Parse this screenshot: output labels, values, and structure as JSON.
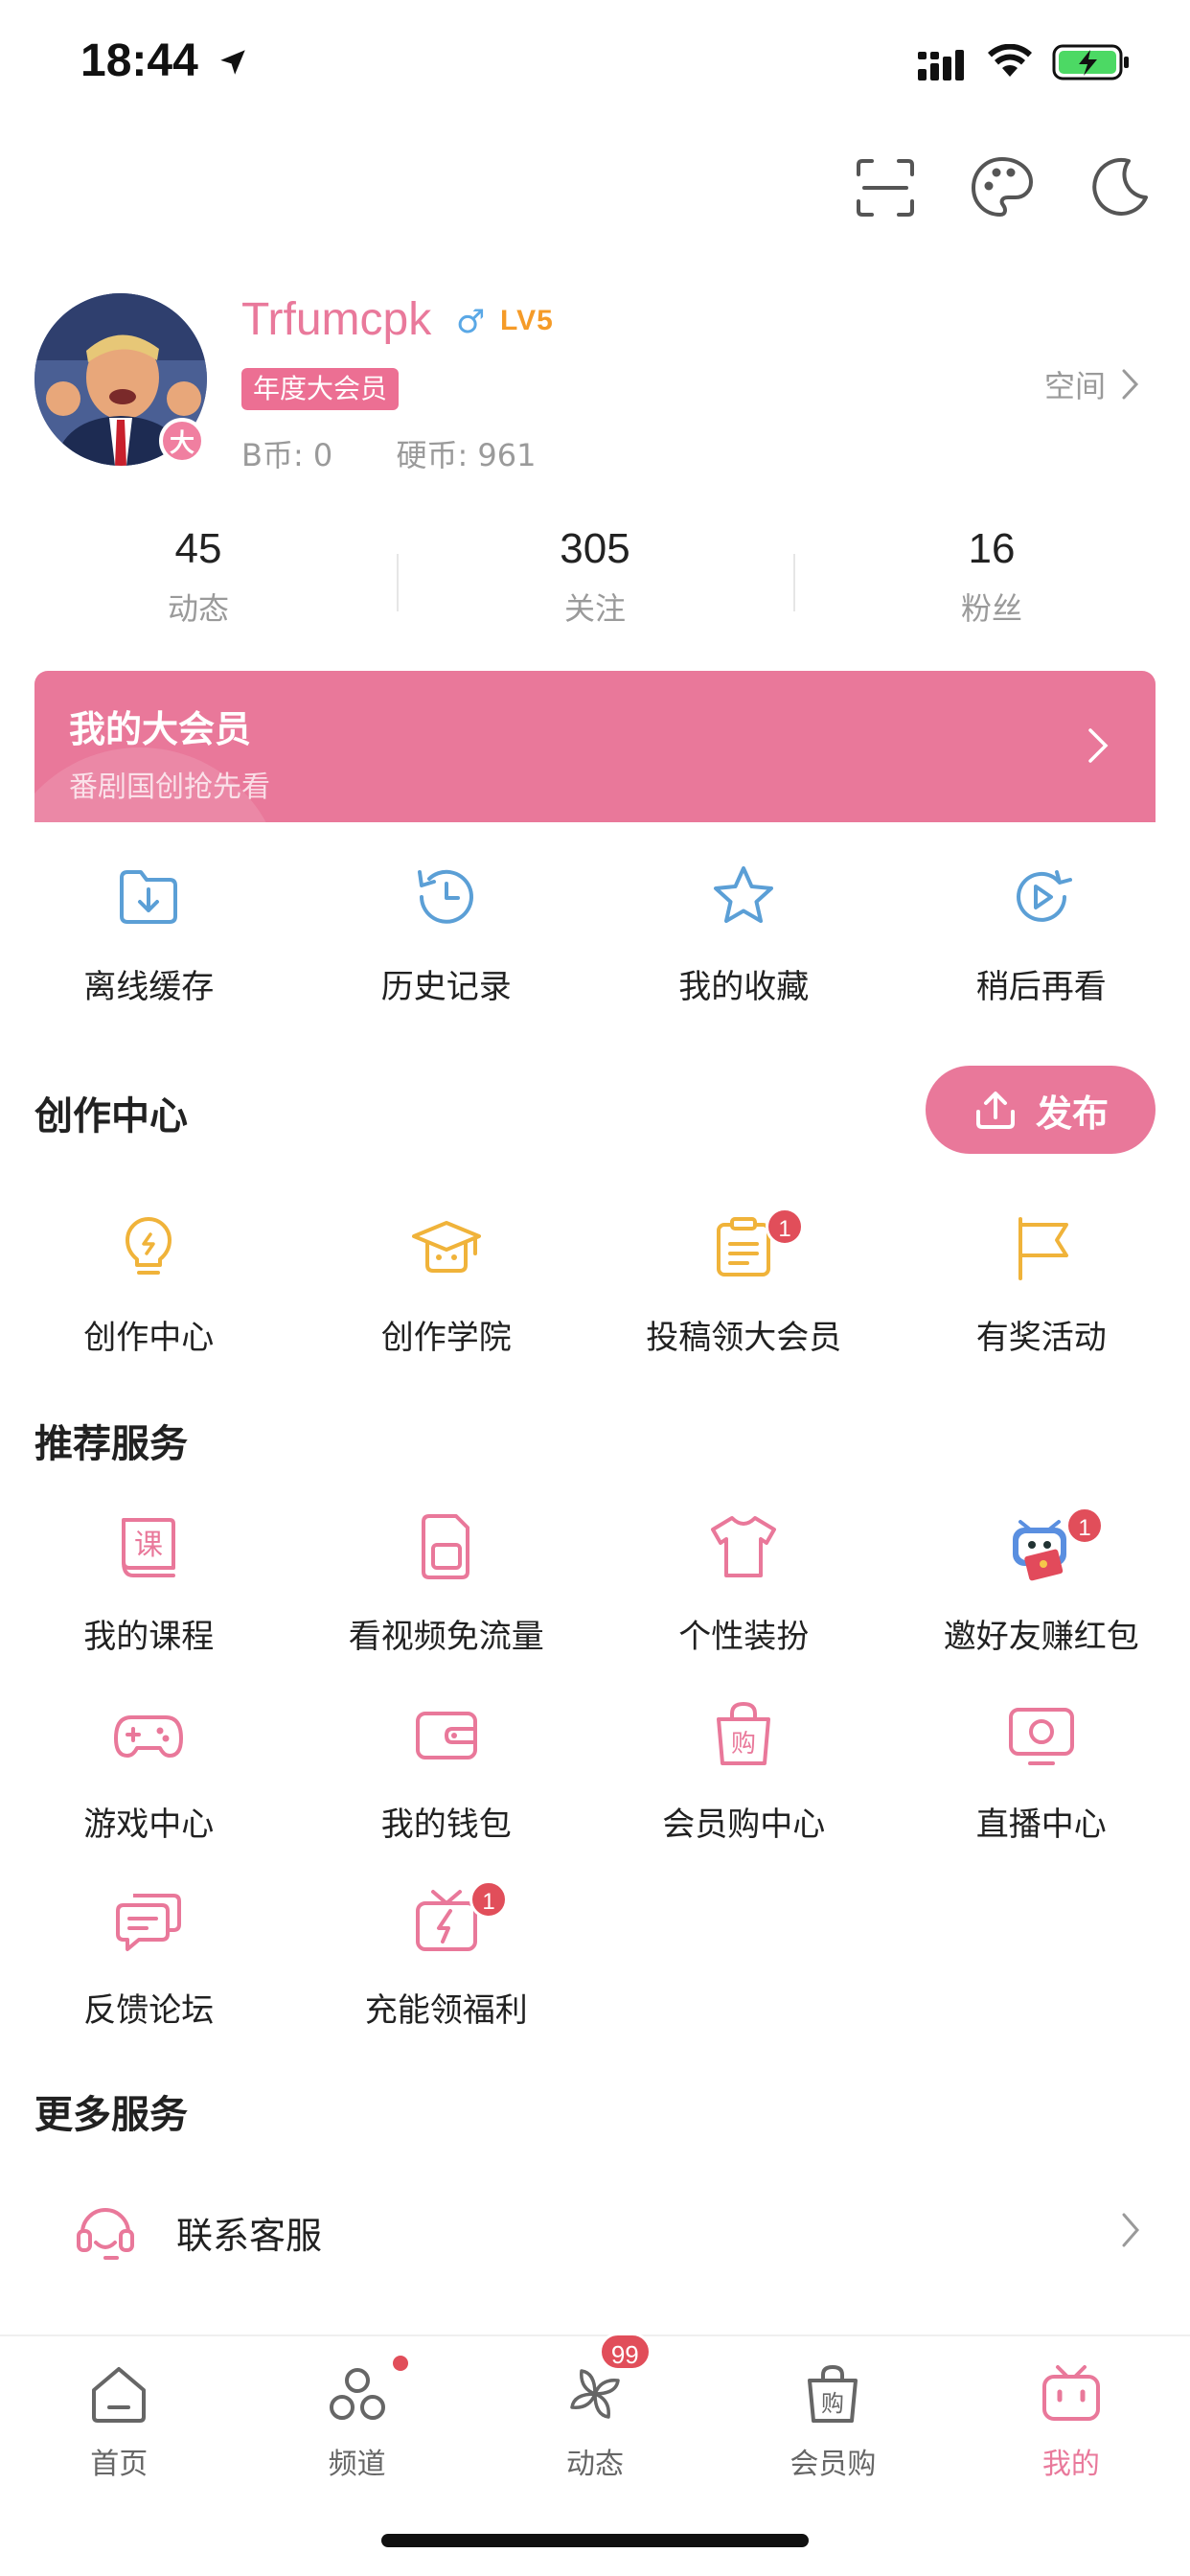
{
  "status_bar": {
    "time": "18:44"
  },
  "profile": {
    "username": "Trfumcpk",
    "gender_symbol": "♂",
    "level": "LV5",
    "avatar_badge": "大",
    "vip_tag": "年度大会员",
    "b_coins": "B币: 0",
    "hard_coins": "硬币: 961",
    "space_label": "空间"
  },
  "stats": [
    {
      "value": "45",
      "label": "动态"
    },
    {
      "value": "305",
      "label": "关注"
    },
    {
      "value": "16",
      "label": "粉丝"
    }
  ],
  "vip_banner": {
    "title": "我的大会员",
    "subtitle": "番剧国创抢先看"
  },
  "quick_actions": [
    {
      "label": "离线缓存",
      "icon": "download-folder-icon"
    },
    {
      "label": "历史记录",
      "icon": "history-clock-icon"
    },
    {
      "label": "我的收藏",
      "icon": "star-icon"
    },
    {
      "label": "稍后再看",
      "icon": "watch-later-icon"
    }
  ],
  "creation": {
    "title": "创作中心",
    "publish_label": "发布",
    "items": [
      {
        "label": "创作中心",
        "icon": "lightbulb-icon"
      },
      {
        "label": "创作学院",
        "icon": "graduation-cap-icon"
      },
      {
        "label": "投稿领大会员",
        "icon": "clipboard-icon",
        "badge": "1"
      },
      {
        "label": "有奖活动",
        "icon": "flag-icon"
      }
    ]
  },
  "recommended": {
    "title": "推荐服务",
    "items": [
      {
        "label": "我的课程",
        "icon": "course-book-icon",
        "glyph": "课"
      },
      {
        "label": "看视频免流量",
        "icon": "sim-card-icon"
      },
      {
        "label": "个性装扮",
        "icon": "tshirt-icon"
      },
      {
        "label": "邀好友赚红包",
        "icon": "mascot-red-envelope-icon",
        "badge": "1"
      },
      {
        "label": "游戏中心",
        "icon": "gamepad-icon"
      },
      {
        "label": "我的钱包",
        "icon": "wallet-icon"
      },
      {
        "label": "会员购中心",
        "icon": "shopping-bag-icon",
        "glyph": "购"
      },
      {
        "label": "直播中心",
        "icon": "live-tv-icon"
      },
      {
        "label": "反馈论坛",
        "icon": "chat-bubbles-icon"
      },
      {
        "label": "充能领福利",
        "icon": "gift-energy-icon",
        "badge": "1"
      }
    ]
  },
  "more": {
    "title": "更多服务",
    "contact_label": "联系客服"
  },
  "tab_bar": [
    {
      "label": "首页",
      "icon": "home-icon"
    },
    {
      "label": "频道",
      "icon": "channels-icon",
      "dot": true
    },
    {
      "label": "动态",
      "icon": "pinwheel-icon",
      "badge": "99"
    },
    {
      "label": "会员购",
      "icon": "shop-bag-icon",
      "glyph": "购"
    },
    {
      "label": "我的",
      "icon": "tv-profile-icon",
      "active": true
    }
  ],
  "colors": {
    "accent_pink": "#e9789a",
    "blue_icon": "#5b9fd6",
    "yellow_icon": "#f0b33a",
    "badge_red": "#e14e5a",
    "level_orange": "#f59b28"
  }
}
